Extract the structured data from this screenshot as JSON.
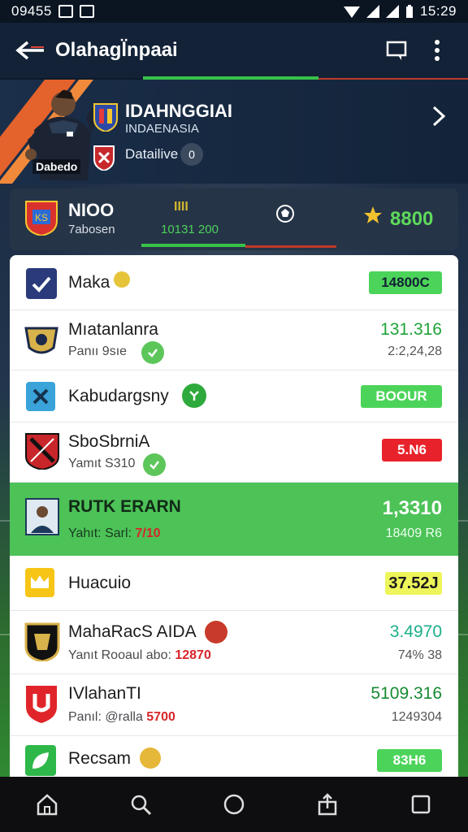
{
  "status_bar": {
    "time_left": "09455",
    "time_right": "15:29"
  },
  "app_bar": {
    "title": "Olahagl̈npaai"
  },
  "hero": {
    "team": "IDAHNGGIAI",
    "country": "INDAENASIA",
    "detail_label": "Datailive",
    "detail_badge": "0",
    "player_tag": "Dabedo"
  },
  "score_card": {
    "name": "NIOO",
    "sub": "7abosen",
    "mid_icon": "IIII",
    "mid_value": "10131 200",
    "points": "8800"
  },
  "colors": {
    "accent_green": "#38c24a",
    "accent_red": "#c0392b",
    "highlight_row": "#4cc257",
    "app_bar": "#132236"
  },
  "rows": [
    {
      "name": "Maka",
      "sub": "",
      "value": "14800C",
      "value_sub": "",
      "style": "pill-green"
    },
    {
      "name": "Mıatanlanra",
      "sub": "Panıı 9sıe",
      "value": "131.316",
      "value_sub": "2:2,24,28",
      "style": "green-text"
    },
    {
      "name": "Kabudargsny",
      "sub": "",
      "value": "BOOUR",
      "value_sub": "",
      "style": "pill-green"
    },
    {
      "name": "SboSbrniA",
      "sub": "Yamıt S310",
      "value": "5.N6",
      "value_sub": "",
      "style": "pill-red"
    },
    {
      "name": "RUTK ERARN",
      "sub_prefix": "Yahıt: Sarl: ",
      "sub_red": "7/10",
      "value": "1,3310",
      "value_sub": "18409 R6",
      "style": "highlight"
    },
    {
      "name": "Huacuio",
      "sub": "",
      "value": "37.52J",
      "value_sub": "",
      "style": "yellow"
    },
    {
      "name": "MahaRacS AIDA",
      "sub_prefix": "Yanıt Rooaul abo: ",
      "sub_red": "12870",
      "value": "3.4970",
      "value_sub": "74% 38",
      "style": "teal-text"
    },
    {
      "name": "IVlahanTI",
      "sub_prefix": "Panıl: @ralla ",
      "sub_red": "5700",
      "value": "5109.316",
      "value_sub": "1249304",
      "style": "dgreen-text"
    },
    {
      "name": "Recsam",
      "sub": "",
      "value": "83H6",
      "value_sub": "",
      "style": "pill-green"
    }
  ]
}
